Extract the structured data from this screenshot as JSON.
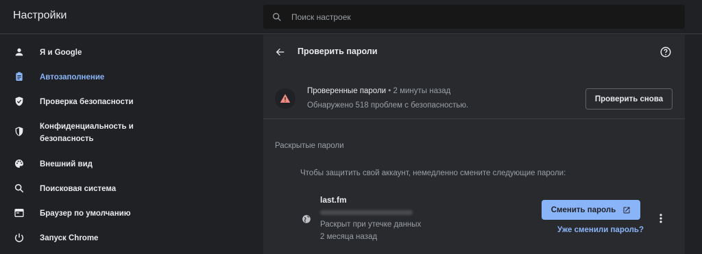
{
  "app": {
    "title": "Настройки"
  },
  "search": {
    "placeholder": "Поиск настроек"
  },
  "sidebar": {
    "items": [
      {
        "label": "Я и Google",
        "icon": "person-icon"
      },
      {
        "label": "Автозаполнение",
        "icon": "clipboard-icon",
        "active": true
      },
      {
        "label": "Проверка безопасности",
        "icon": "shield-check-icon"
      },
      {
        "label_line1": "Конфиденциальность и",
        "label_line2": "безопасность",
        "icon": "shield-icon"
      },
      {
        "label": "Внешний вид",
        "icon": "palette-icon"
      },
      {
        "label": "Поисковая система",
        "icon": "search-icon"
      },
      {
        "label": "Браузер по умолчанию",
        "icon": "browser-icon"
      },
      {
        "label": "Запуск Chrome",
        "icon": "power-icon"
      }
    ]
  },
  "panel": {
    "title": "Проверить пароли",
    "check": {
      "title": "Проверенные пароли",
      "time": " • 2 минуты назад",
      "summary": "Обнаружено 518 проблем с безопасностью.",
      "recheck_label": "Проверить снова"
    },
    "section": {
      "title": "Раскрытые пароли",
      "description": "Чтобы защитить свой аккаунт, немедленно смените следующие пароли:"
    },
    "entry": {
      "site": "last.fm",
      "status": "Раскрыт при утечке данных",
      "ago": "2 месяца назад",
      "change_label": "Сменить пароль",
      "already_changed_label": "Уже сменили пароль?"
    }
  },
  "colors": {
    "background": "#202124",
    "panel": "#292a2d",
    "accent": "#8ab4f8",
    "warning": "#f28b82"
  }
}
